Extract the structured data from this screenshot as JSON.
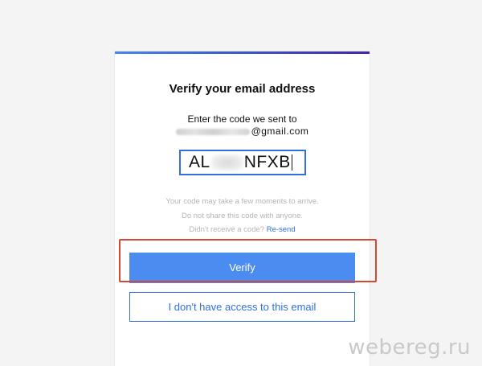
{
  "dialog": {
    "title": "Verify your email address",
    "prompt": "Enter the code we sent to",
    "email_suffix": "@gmail.com",
    "code_prefix": "AL",
    "code_suffix": "NFXB",
    "hint_line1": "Your code may take a few moments to arrive.",
    "hint_line2": "Do not share this code with anyone.",
    "hint_line3": "Didn't receive a code?",
    "resend_label": "Re-send",
    "verify_label": "Verify",
    "no_access_label": "I don't have access to this email"
  },
  "watermark": "webereg.ru",
  "colors": {
    "accent": "#4a8cf0",
    "link": "#2f6fe0",
    "highlight": "#d24a36"
  }
}
